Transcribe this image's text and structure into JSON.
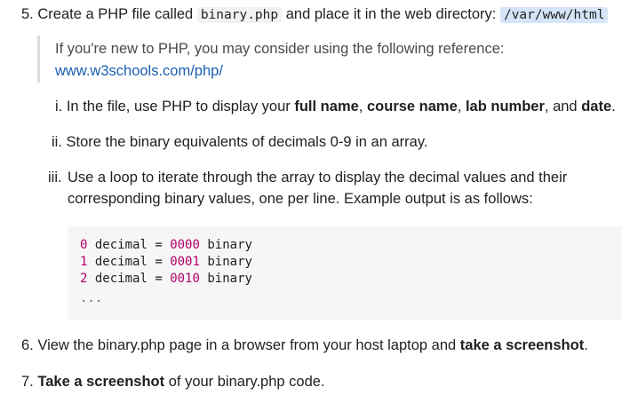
{
  "item5": {
    "number": "5.",
    "text_before": "Create a PHP file called",
    "filename": "binary.php",
    "text_middle": "and place it in the web directory:",
    "directory": "/var/www/html"
  },
  "reference": {
    "line1": "If you're new to PHP, you may consider using the following reference:",
    "link": "www.w3schools.com/php/"
  },
  "sub_i": {
    "marker": "i.",
    "text_a": "In the file, use PHP to display your",
    "b1": "full name",
    "sep1": ",",
    "b2": "course name",
    "sep2": ",",
    "b3": "lab number",
    "sep3": ", and",
    "b4": "date",
    "end": "."
  },
  "sub_ii": {
    "marker": "ii.",
    "text": "Store the binary equivalents of decimals 0-9 in an array."
  },
  "sub_iii": {
    "marker": "iii.",
    "line1": "Use a loop to iterate through the array to display the decimal values and their",
    "line2": "corresponding binary values, one per line. Example output is as follows:"
  },
  "code_lines": [
    {
      "n": "0",
      "w1": "decimal",
      "eq": "=",
      "bin": "0000",
      "w2": "binary"
    },
    {
      "n": "1",
      "w1": "decimal",
      "eq": "=",
      "bin": "0001",
      "w2": "binary"
    },
    {
      "n": "2",
      "w1": "decimal",
      "eq": "=",
      "bin": "0010",
      "w2": "binary"
    }
  ],
  "code_ellipsis": "...",
  "item6": {
    "number": "6.",
    "text": "View the binary.php page in a browser from your host laptop and",
    "bold": "take a screenshot",
    "end": "."
  },
  "item7": {
    "number": "7.",
    "bold": "Take a screenshot",
    "text": "of your binary.php code."
  },
  "colors": {
    "link": "#1a5fb4",
    "code_number": "#b3006b",
    "code_bg": "#f6f6f6",
    "highlight": "#d6e4f7"
  }
}
